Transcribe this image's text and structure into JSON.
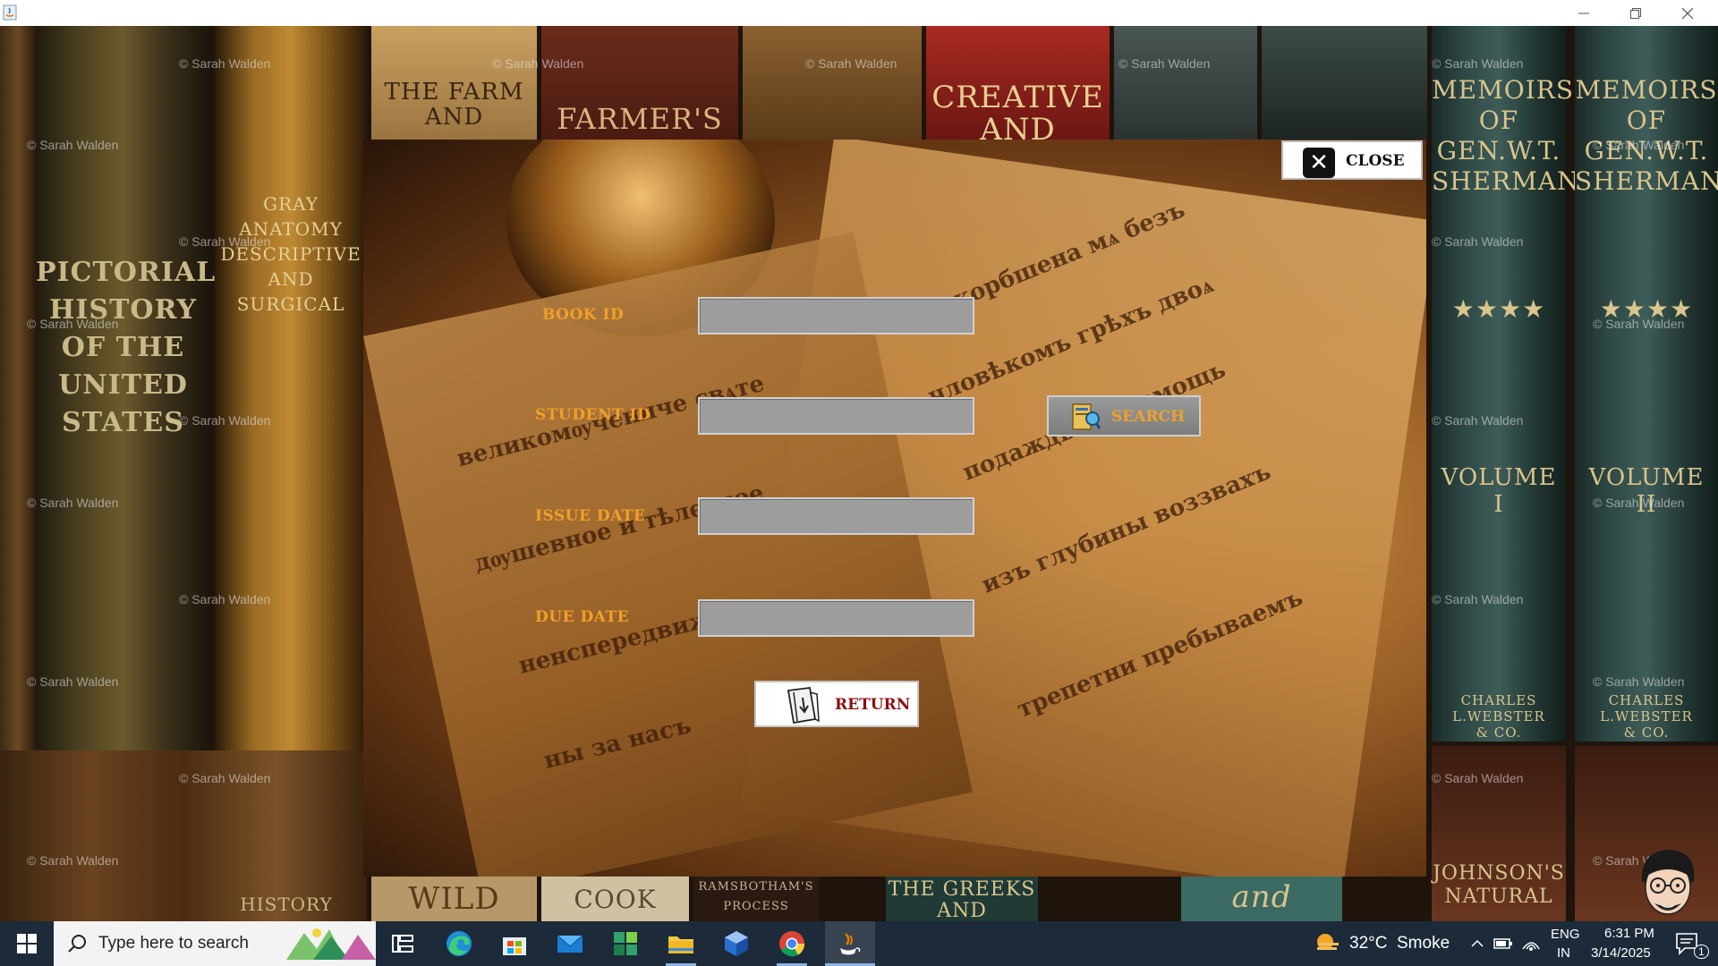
{
  "window": {
    "minimize_icon": "minimize-icon",
    "maximize_icon": "restore-icon",
    "close_icon": "close-icon"
  },
  "background": {
    "watermark": "© Sarah Walden",
    "spines": {
      "pictorial": "PICTORIAL\nHISTORY\nOF THE\nUNITED STATES",
      "anatomy": "GRAY\nANATOMY\nDESCRIPTIVE\nAND\nSURGICAL",
      "farm": "THE FARM\nAND",
      "farmers": "FARMER'S",
      "creative": "CREATIVE\nAND",
      "memoirs": "MEMOIRS\nOF\nGEN.W.T.\nSHERMAN",
      "volume_1": "VOLUME\nI",
      "volume_2": "VOLUME\nII",
      "publisher": "CHARLES L.WEBSTER\n& CO.",
      "bottom_1": "WILD",
      "bottom_2": "COOK",
      "bottom_3": "RAMSBOTHAM'S\nPROCESS",
      "bottom_4": "THE GREEKS\nAND",
      "bottom_5": "and",
      "bottom_6": "JOHNSON'S\nNATURAL",
      "bottom_7": "HISTORY"
    }
  },
  "dialog": {
    "close_label": "CLOSE",
    "fields": {
      "book_id": {
        "label": "BOOK ID",
        "value": ""
      },
      "student_id": {
        "label": "STUDENT ID",
        "value": ""
      },
      "issue_date": {
        "label": "ISSUE DATE",
        "value": ""
      },
      "due_date": {
        "label": "DUE DATE",
        "value": ""
      }
    },
    "search_label": "SEARCH",
    "return_label": "RETURN"
  },
  "taskbar": {
    "search_placeholder": "Type here to search",
    "weather": "32°C  Smoke",
    "language": "ENG",
    "region": "IN",
    "time": "6:31 PM",
    "date": "3/14/2025",
    "notification_count": "1"
  }
}
